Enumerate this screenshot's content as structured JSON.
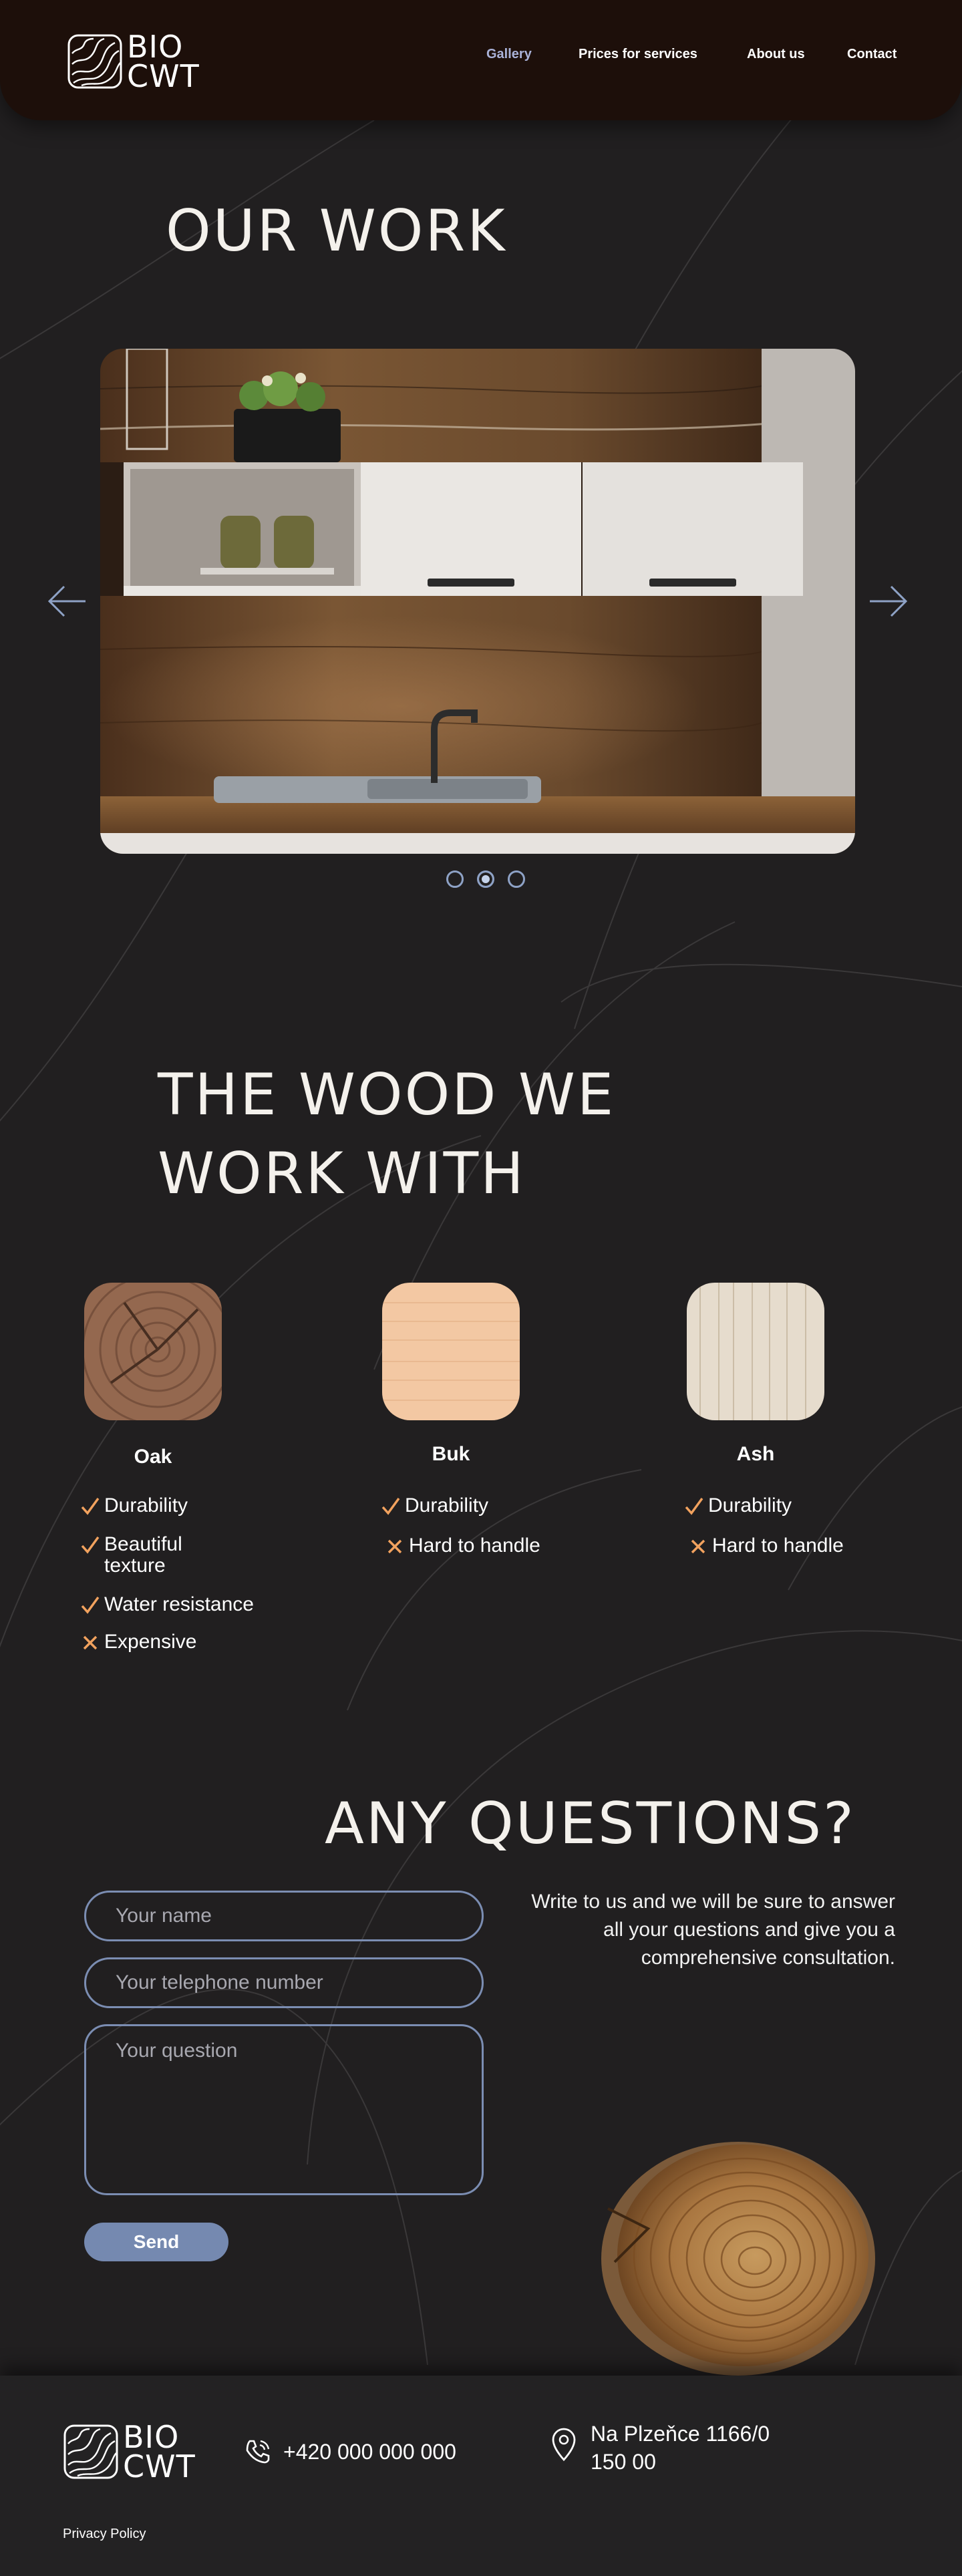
{
  "logo": {
    "line1": "BIO",
    "line2": "CWT"
  },
  "nav": {
    "items": [
      {
        "label": "Gallery",
        "active": true
      },
      {
        "label": "Prices for services",
        "active": false
      },
      {
        "label": "About us",
        "active": false
      },
      {
        "label": "Contact",
        "active": false
      }
    ]
  },
  "gallery": {
    "title": "OUR WORK",
    "slide_count": 3,
    "active_slide": 2
  },
  "woods": {
    "title_line1": "THE WOOD WE",
    "title_line2": "WORK WITH",
    "items": [
      {
        "name": "Oak",
        "features": [
          {
            "text": "Durability",
            "positive": true
          },
          {
            "text": "Beautiful texture",
            "positive": true
          },
          {
            "text": "Water resistance",
            "positive": true
          },
          {
            "text": "Expensive",
            "positive": false
          }
        ]
      },
      {
        "name": "Buk",
        "features": [
          {
            "text": "Durability",
            "positive": true
          },
          {
            "text": "Hard to handle",
            "positive": false
          }
        ]
      },
      {
        "name": "Ash",
        "features": [
          {
            "text": "Durability",
            "positive": true
          },
          {
            "text": "Hard to handle",
            "positive": false
          }
        ]
      }
    ]
  },
  "questions": {
    "title": "ANY QUESTIONS?",
    "text": "Write to us and we will be sure to answer all your questions and give you a comprehensive consultation.",
    "name_placeholder": "Your name",
    "phone_placeholder": "Your telephone number",
    "question_placeholder": "Your question",
    "send_label": "Send"
  },
  "footer": {
    "phone": "+420 000 000 000",
    "address_line1": "Na Plzeňce 1166/0",
    "address_line2": "150 00",
    "privacy": "Privacy Policy"
  },
  "colors": {
    "background": "#211f20",
    "header": "#1d0f0a",
    "accent": "#7589b0",
    "nav_active": "#aab2d8",
    "check": "#f2a25e"
  }
}
